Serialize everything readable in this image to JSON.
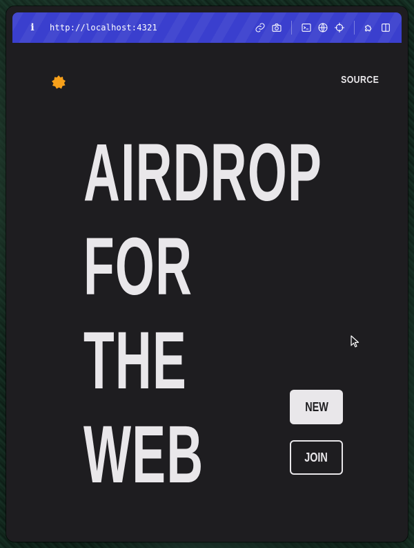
{
  "browser": {
    "url": "http://localhost:4321",
    "toolbar_icons": [
      "link-icon",
      "camera-icon",
      "terminal-icon",
      "globe-icon",
      "crosshair-icon",
      "puzzle-icon",
      "sidebar-icon"
    ]
  },
  "page": {
    "source_label": "SOURCE",
    "headline": [
      "AIRDROP",
      "FOR",
      "THE",
      "WEB"
    ],
    "new_button": "NEW",
    "join_button": "JOIN"
  },
  "colors": {
    "toolbar": "#3a3fce",
    "background": "#1e1d20",
    "foreground": "#e9e7ea",
    "accent": "#f7a01a"
  }
}
